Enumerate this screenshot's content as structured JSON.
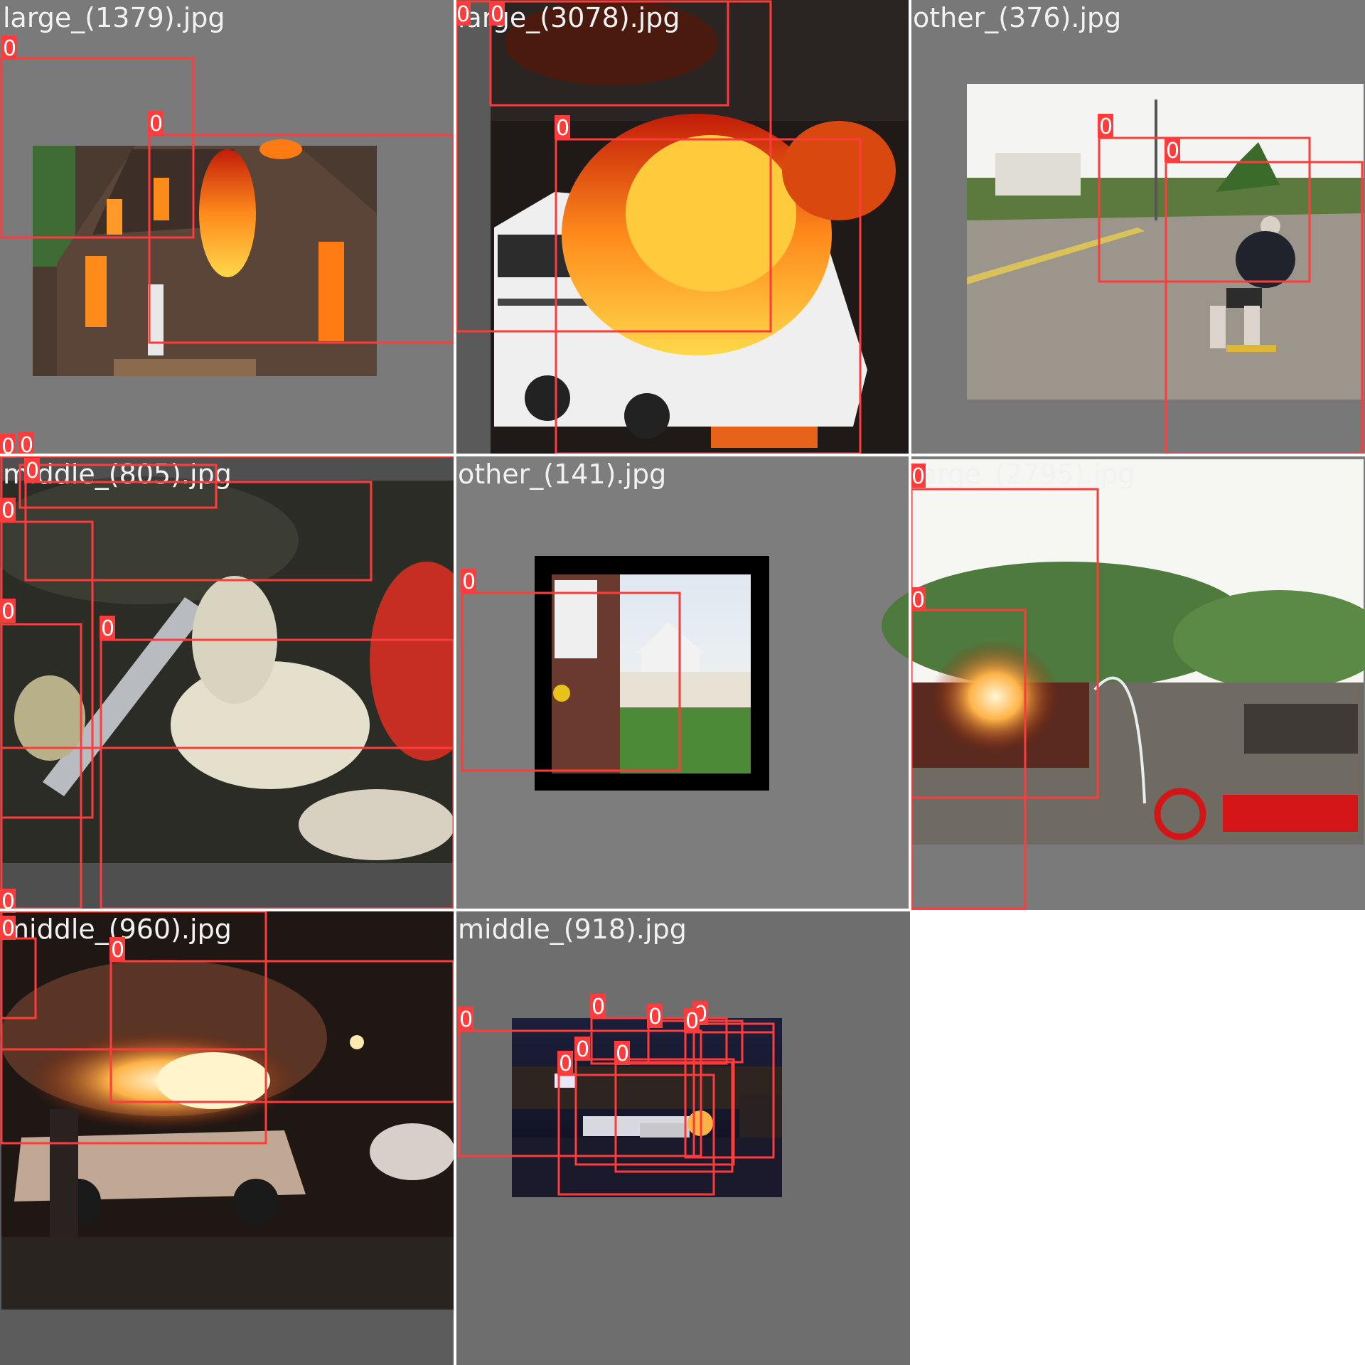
{
  "grid": {
    "tiles": [
      {
        "name": "large_(1379).jpg",
        "scene": "burning-house",
        "background_color": "#7a7a7a",
        "boxes": [
          {
            "class_label": "0"
          },
          {
            "class_label": "0"
          }
        ]
      },
      {
        "name": "large_(3078).jpg",
        "scene": "burning-bus",
        "background_color": "#5a5a5a",
        "boxes": [
          {
            "class_label": "0"
          },
          {
            "class_label": "0"
          },
          {
            "class_label": "0"
          }
        ]
      },
      {
        "name": "other_(376).jpg",
        "scene": "skateboarder-street",
        "background_color": "#787878",
        "boxes": [
          {
            "class_label": "0"
          },
          {
            "class_label": "0"
          }
        ]
      },
      {
        "name": "middle_(805).jpg",
        "scene": "firefighting-hose",
        "background_color": "#4f4f4f",
        "boxes": [
          {
            "class_label": "0"
          },
          {
            "class_label": "0"
          },
          {
            "class_label": "0"
          },
          {
            "class_label": "0"
          },
          {
            "class_label": "0"
          },
          {
            "class_label": "0"
          }
        ]
      },
      {
        "name": "other_(141).jpg",
        "scene": "house-yard",
        "background_color": "#7d7d7d",
        "boxes": [
          {
            "class_label": "0"
          }
        ]
      },
      {
        "name": "large_(2795).jpg",
        "scene": "burning-building-hillside",
        "background_color": "#7a7a7a",
        "boxes": [
          {
            "class_label": "0"
          },
          {
            "class_label": "0"
          }
        ]
      },
      {
        "name": "middle_(960).jpg",
        "scene": "burning-car-night",
        "background_color": "#5c5c5c",
        "boxes": [
          {
            "class_label": "0"
          },
          {
            "class_label": "0"
          },
          {
            "class_label": "0"
          },
          {
            "class_label": "0"
          }
        ]
      },
      {
        "name": "middle_(918).jpg",
        "scene": "night-street-fire",
        "background_color": "#6e6e6e",
        "boxes": [
          {
            "class_label": "0"
          },
          {
            "class_label": "0"
          },
          {
            "class_label": "0"
          },
          {
            "class_label": "0"
          },
          {
            "class_label": "0"
          },
          {
            "class_label": "0"
          },
          {
            "class_label": "0"
          },
          {
            "class_label": "0"
          }
        ]
      }
    ]
  },
  "colors": {
    "box": "#ff3b3b",
    "label_text": "#f2f2f2",
    "page_background": "#ffffff"
  }
}
